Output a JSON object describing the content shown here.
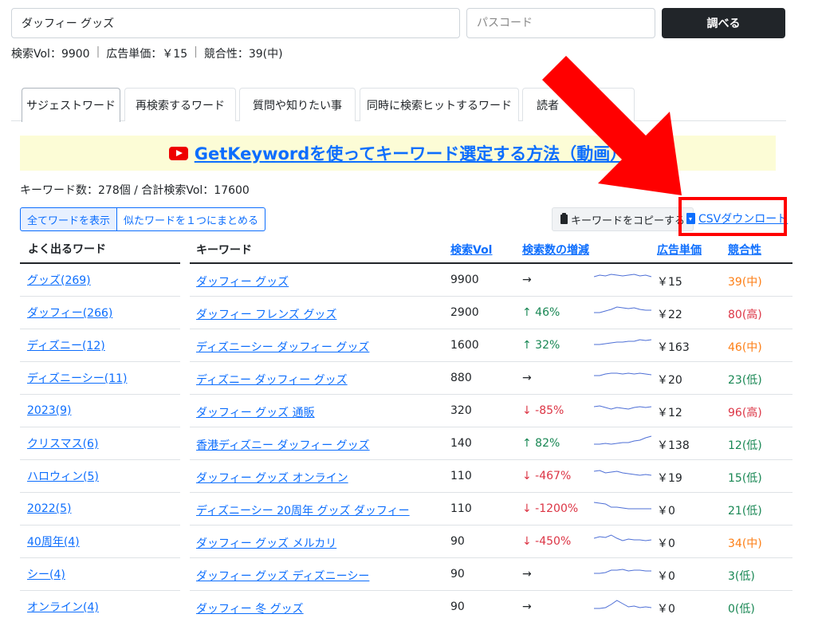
{
  "search": {
    "value": "ダッフィー グッズ",
    "password_placeholder": "パスコード",
    "button_label": "調べる"
  },
  "stats": {
    "volume": "検索Vol：9900",
    "cpc": "広告単価：￥15",
    "competition": "競合性：39(中)",
    "separator": "|"
  },
  "tabs": [
    {
      "label": "サジェストワード"
    },
    {
      "label": "再検索するワード"
    },
    {
      "label": "質問や知りたい事"
    },
    {
      "label": "同時に検索ヒットするワード"
    },
    {
      "label": "読者"
    }
  ],
  "banner": {
    "text": "GetKeywordを使ってキーワード選定する方法（動画）"
  },
  "summary": {
    "text": "キーワード数：278個 / 合計検索Vol：17600"
  },
  "group_buttons": {
    "all": "全てワードを表示",
    "group": "似たワードを１つにまとめる"
  },
  "actions": {
    "copy": "キーワードをコピーする",
    "csv": "CSVダウンロード"
  },
  "frequent": {
    "header": "よく出るワード",
    "items": [
      "グッズ(269)",
      "ダッフィー(266)",
      "ディズニー(12)",
      "ディズニーシー(11)",
      "2023(9)",
      "クリスマス(6)",
      "ハロウィン(5)",
      "2022(5)",
      "40周年(4)",
      "シー(4)",
      "オンライン(4)"
    ]
  },
  "columns": {
    "keyword": "キーワード",
    "volume": "検索Vol",
    "trend": "検索数の増減",
    "cpc": "広告単価",
    "competition": "競合性"
  },
  "rows": [
    {
      "keyword": "ダッフィー グッズ",
      "volume": "9900",
      "trend": "→",
      "dir": "flat",
      "cpc": "￥15",
      "comp": "39(中)",
      "level": "mid",
      "spark": [
        6,
        4,
        5,
        3,
        4,
        5,
        4,
        3,
        5,
        4,
        6
      ]
    },
    {
      "keyword": "ダッフィー フレンズ グッズ",
      "volume": "2900",
      "trend": "↑ 46%",
      "dir": "up",
      "cpc": "￥22",
      "comp": "80(高)",
      "level": "high",
      "spark": [
        10,
        10,
        8,
        6,
        3,
        4,
        5,
        4,
        6,
        7,
        7
      ]
    },
    {
      "keyword": "ディズニーシー ダッフィー グッズ",
      "volume": "1600",
      "trend": "↑ 32%",
      "dir": "up",
      "cpc": "￥163",
      "comp": "46(中)",
      "level": "mid",
      "spark": [
        9,
        9,
        8,
        7,
        6,
        6,
        5,
        5,
        3,
        4,
        3
      ]
    },
    {
      "keyword": "ディズニー ダッフィー グッズ",
      "volume": "880",
      "trend": "→",
      "dir": "flat",
      "cpc": "￥20",
      "comp": "23(低)",
      "level": "low",
      "spark": [
        7,
        7,
        5,
        4,
        4,
        5,
        4,
        5,
        4,
        5,
        6
      ]
    },
    {
      "keyword": "ダッフィー グッズ 通販",
      "volume": "320",
      "trend": "↓ -85%",
      "dir": "down",
      "cpc": "￥12",
      "comp": "96(高)",
      "level": "high",
      "spark": [
        5,
        4,
        6,
        8,
        6,
        7,
        8,
        6,
        5,
        6,
        5
      ]
    },
    {
      "keyword": "香港ディズニー ダッフィー グッズ",
      "volume": "140",
      "trend": "↑ 82%",
      "dir": "up",
      "cpc": "￥138",
      "comp": "12(低)",
      "level": "low",
      "spark": [
        11,
        11,
        10,
        11,
        10,
        9,
        9,
        7,
        6,
        3,
        1
      ]
    },
    {
      "keyword": "ダッフィー グッズ オンライン",
      "volume": "110",
      "trend": "↓ -467%",
      "dir": "down",
      "cpc": "￥19",
      "comp": "15(低)",
      "level": "low",
      "spark": [
        4,
        3,
        6,
        5,
        4,
        6,
        7,
        8,
        9,
        8,
        9
      ]
    },
    {
      "keyword": "ディズニーシー 20周年 グッズ ダッフィー",
      "volume": "110",
      "trend": "↓ -1200%",
      "dir": "down",
      "cpc": "￥0",
      "comp": "21(低)",
      "level": "low",
      "spark": [
        2,
        3,
        4,
        8,
        8,
        9,
        10,
        10,
        10,
        10,
        10
      ]
    },
    {
      "keyword": "ダッフィー グッズ メルカリ",
      "volume": "90",
      "trend": "↓ -450%",
      "dir": "down",
      "cpc": "￥0",
      "comp": "34(中)",
      "level": "mid",
      "spark": [
        6,
        4,
        5,
        2,
        6,
        9,
        7,
        8,
        8,
        9,
        8
      ]
    },
    {
      "keyword": "ダッフィー グッズ ディズニーシー",
      "volume": "90",
      "trend": "→",
      "dir": "flat",
      "cpc": "￥0",
      "comp": "3(低)",
      "level": "low",
      "spark": [
        9,
        9,
        8,
        5,
        5,
        4,
        6,
        5,
        5,
        6,
        6
      ]
    },
    {
      "keyword": "ダッフィー 冬 グッズ",
      "volume": "90",
      "trend": "→",
      "dir": "flat",
      "cpc": "￥0",
      "comp": "0(低)",
      "level": "low",
      "spark": [
        12,
        12,
        11,
        7,
        2,
        6,
        10,
        9,
        11,
        10,
        11
      ]
    }
  ]
}
